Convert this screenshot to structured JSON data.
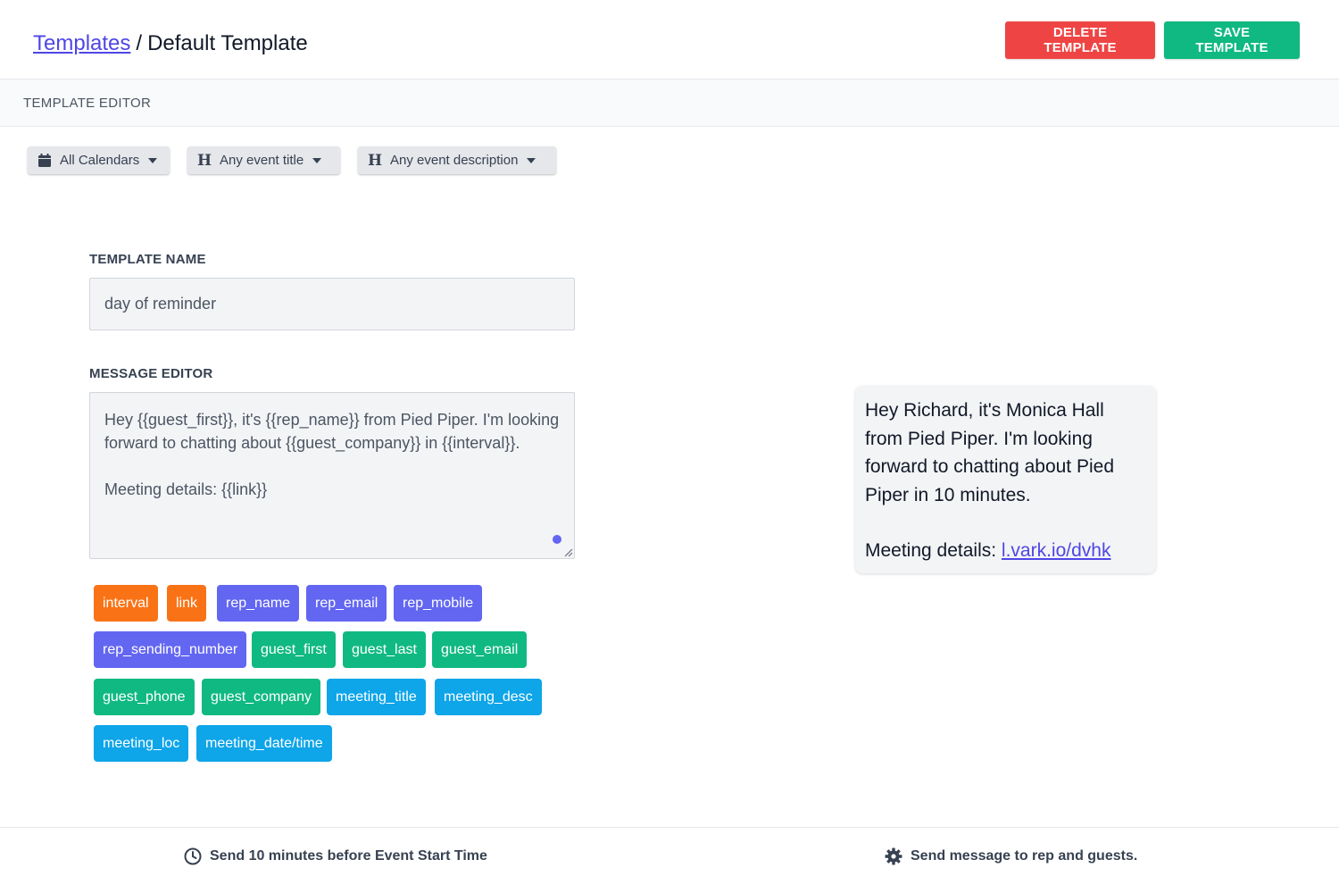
{
  "header": {
    "breadcrumb_link": "Templates",
    "separator": "/",
    "breadcrumb_current": "Default Template",
    "delete_label": "DELETE TEMPLATE",
    "save_label": "SAVE TEMPLATE"
  },
  "editor_bar": {
    "title": "TEMPLATE EDITOR"
  },
  "filters": [
    {
      "label": "All Calendars",
      "icon": "calendar-icon"
    },
    {
      "label": "Any event title",
      "icon": "heading-icon"
    },
    {
      "label": "Any event description",
      "icon": "heading-icon"
    }
  ],
  "form": {
    "name_label": "TEMPLATE NAME",
    "name_value": "day of reminder",
    "message_label": "MESSAGE EDITOR",
    "message_value": "Hey {{guest_first}}, it's {{rep_name}} from Pied Piper. I'm looking forward to chatting about {{guest_company}} in {{interval}}.\n\nMeeting details: {{link}}"
  },
  "tags": [
    {
      "label": "interval",
      "color": "#f97316"
    },
    {
      "label": "link",
      "color": "#f97316"
    },
    {
      "label": "rep_name",
      "color": "#6366f1"
    },
    {
      "label": "rep_email",
      "color": "#6366f1"
    },
    {
      "label": "rep_mobile",
      "color": "#6366f1"
    },
    {
      "label": "rep_sending_number",
      "color": "#6366f1"
    },
    {
      "label": "guest_first",
      "color": "#10b981"
    },
    {
      "label": "guest_last",
      "color": "#10b981"
    },
    {
      "label": "guest_email",
      "color": "#10b981"
    },
    {
      "label": "guest_phone",
      "color": "#10b981"
    },
    {
      "label": "guest_company",
      "color": "#10b981"
    },
    {
      "label": "meeting_title",
      "color": "#0ea5e9"
    },
    {
      "label": "meeting_desc",
      "color": "#0ea5e9"
    },
    {
      "label": "meeting_loc",
      "color": "#0ea5e9"
    },
    {
      "label": "meeting_date/time",
      "color": "#0ea5e9"
    }
  ],
  "preview": {
    "text": "Hey Richard, it's Monica Hall from Pied Piper. I'm looking forward to chatting about Pied Piper in 10 minutes.",
    "details_prefix": "Meeting details: ",
    "details_link": "l.vark.io/dvhk"
  },
  "footer": {
    "timing": "Send 10 minutes before Event Start Time",
    "recipients": "Send message to rep and guests."
  },
  "colors": {
    "accent": "#4f46e5",
    "delete": "#ef4444",
    "save": "#10b981"
  }
}
